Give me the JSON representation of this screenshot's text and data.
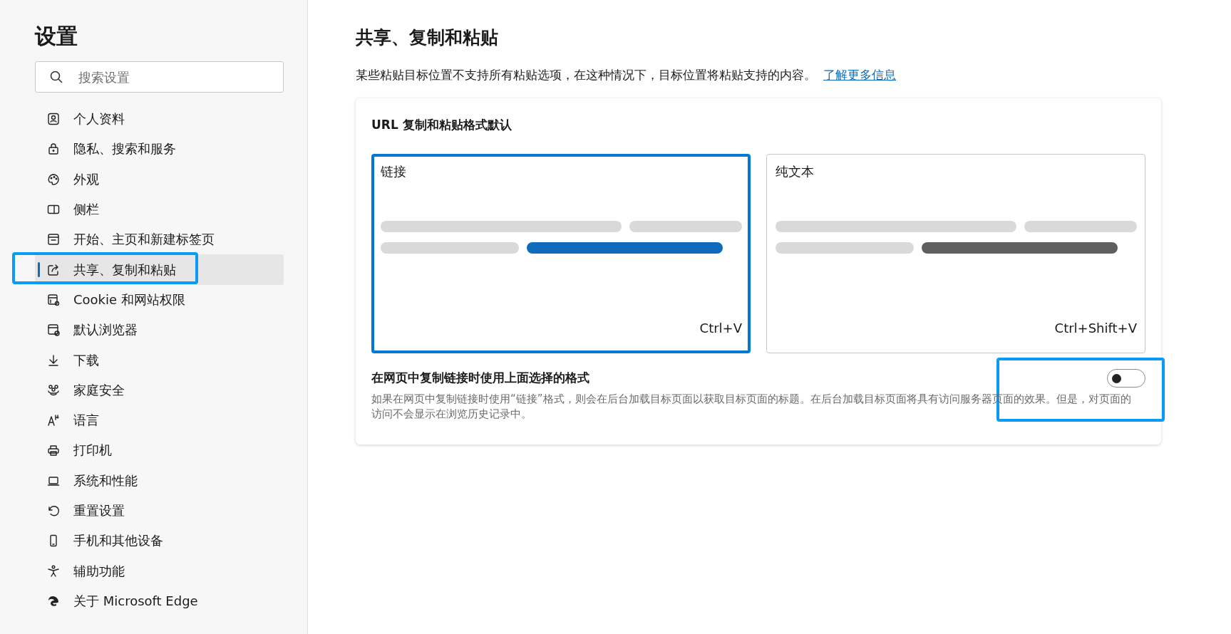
{
  "sidebar": {
    "title": "设置",
    "search": {
      "placeholder": "搜索设置"
    },
    "items": [
      {
        "label": "个人资料",
        "selected": false,
        "highlighted": false
      },
      {
        "label": "隐私、搜索和服务",
        "selected": false,
        "highlighted": false
      },
      {
        "label": "外观",
        "selected": false,
        "highlighted": false
      },
      {
        "label": "侧栏",
        "selected": false,
        "highlighted": false
      },
      {
        "label": "开始、主页和新建标签页",
        "selected": false,
        "highlighted": false
      },
      {
        "label": "共享、复制和粘贴",
        "selected": true,
        "highlighted": true
      },
      {
        "label": "Cookie 和网站权限",
        "selected": false,
        "highlighted": false
      },
      {
        "label": "默认浏览器",
        "selected": false,
        "highlighted": false
      },
      {
        "label": "下载",
        "selected": false,
        "highlighted": false
      },
      {
        "label": "家庭安全",
        "selected": false,
        "highlighted": false
      },
      {
        "label": "语言",
        "selected": false,
        "highlighted": false
      },
      {
        "label": "打印机",
        "selected": false,
        "highlighted": false
      },
      {
        "label": "系统和性能",
        "selected": false,
        "highlighted": false
      },
      {
        "label": "重置设置",
        "selected": false,
        "highlighted": false
      },
      {
        "label": "手机和其他设备",
        "selected": false,
        "highlighted": false
      },
      {
        "label": "辅助功能",
        "selected": false,
        "highlighted": false
      },
      {
        "label": "关于 Microsoft Edge",
        "selected": false,
        "highlighted": false
      }
    ]
  },
  "page": {
    "title": "共享、复制和粘贴",
    "description": "某些粘贴目标位置不支持所有粘贴选项，在这种情况下，目标位置将粘贴支持的内容。",
    "link": "了解更多信息"
  },
  "card": {
    "heading": "URL 复制和粘贴格式默认",
    "options": [
      {
        "label": "链接",
        "shortcut": "Ctrl+V",
        "selected": true
      },
      {
        "label": "纯文本",
        "shortcut": "Ctrl+Shift+V",
        "selected": false
      }
    ],
    "setting": {
      "label": "在网页中复制链接时使用上面选择的格式",
      "description": "如果在网页中复制链接时使用“链接”格式，则会在后台加载目标页面以获取目标页面的标题。在后台加载目标页面将具有访问服务器页面的效果。但是，对页面的访问不会显示在浏览历史记录中。",
      "on": false,
      "highlighted": true
    }
  }
}
